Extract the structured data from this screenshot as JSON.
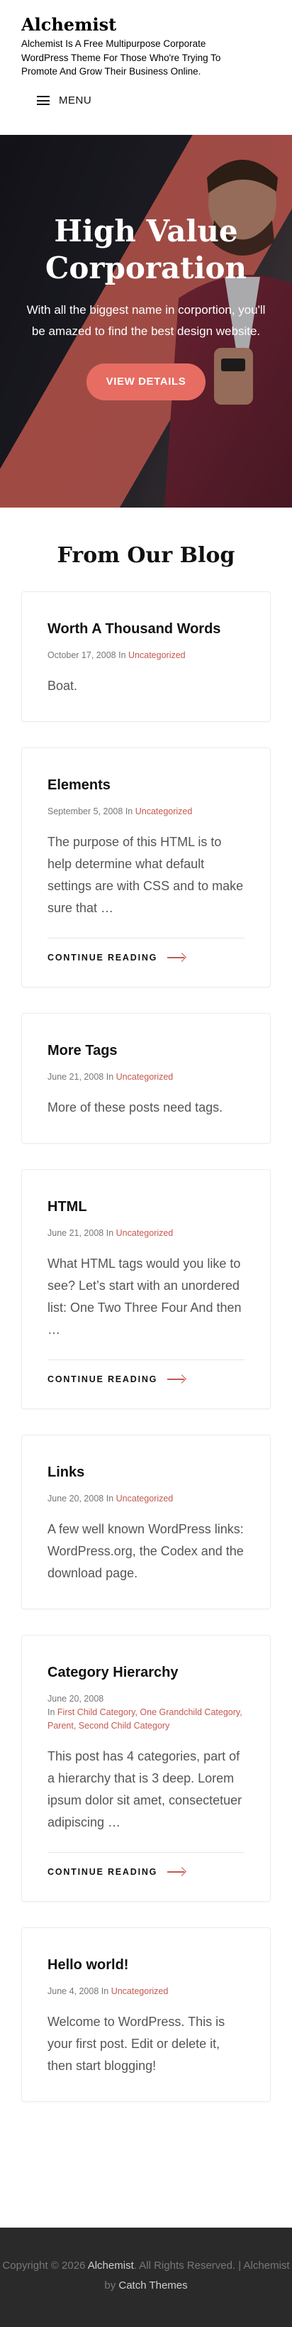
{
  "site": {
    "title": "Alchemist",
    "description": "Alchemist Is A Free Multipurpose Corporate WordPress Theme For Those Who're Trying To Promote And Grow Their Business Online."
  },
  "menu": {
    "label": "MENU"
  },
  "hero": {
    "title": "High Value Corporation",
    "text": "With all the biggest name in corportion, you'll be amazed to find the best design website.",
    "button": "VIEW DETAILS",
    "accent": "#e76d63"
  },
  "blog": {
    "section_title": "From Our Blog",
    "continue_label": "CONTINUE READING",
    "in_label": "In",
    "posts": [
      {
        "title": "Worth A Thousand Words",
        "date": "October 17, 2008",
        "categories": "Uncategorized",
        "excerpt": "Boat."
      },
      {
        "title": "Elements",
        "date": "September 5, 2008",
        "categories": "Uncategorized",
        "excerpt": "The purpose of this HTML is to help determine what default settings are with CSS and to make sure that …"
      },
      {
        "title": "More Tags",
        "date": "June 21, 2008",
        "categories": "Uncategorized",
        "excerpt": "More of these posts need tags."
      },
      {
        "title": "HTML",
        "date": "June 21, 2008",
        "categories": "Uncategorized",
        "excerpt": "What HTML tags would you like to see? Let’s start with an unordered list: One Two Three Four And then …"
      },
      {
        "title": "Links",
        "date": "June 20, 2008",
        "categories": "Uncategorized",
        "excerpt": "A few well known WordPress links: WordPress.org, the Codex and the download page."
      },
      {
        "title": "Category Hierarchy",
        "date": "June 20, 2008",
        "categories": "First Child Category, One Grandchild Category, Parent, Second Child Category",
        "excerpt": "This post has 4 categories, part of a hierarchy that is 3 deep. Lorem ipsum dolor sit amet, consectetuer adipiscing …"
      },
      {
        "title": "Hello world!",
        "date": "June 4, 2008",
        "categories": "Uncategorized",
        "excerpt": "Welcome to WordPress. This is your first post. Edit or delete it, then start blogging!"
      }
    ]
  },
  "footer": {
    "copyright": "Copyright © 2026",
    "site_name": "Alchemist",
    "rights": ". All Rights Reserved. | Alchemist by",
    "author": "Catch Themes"
  }
}
